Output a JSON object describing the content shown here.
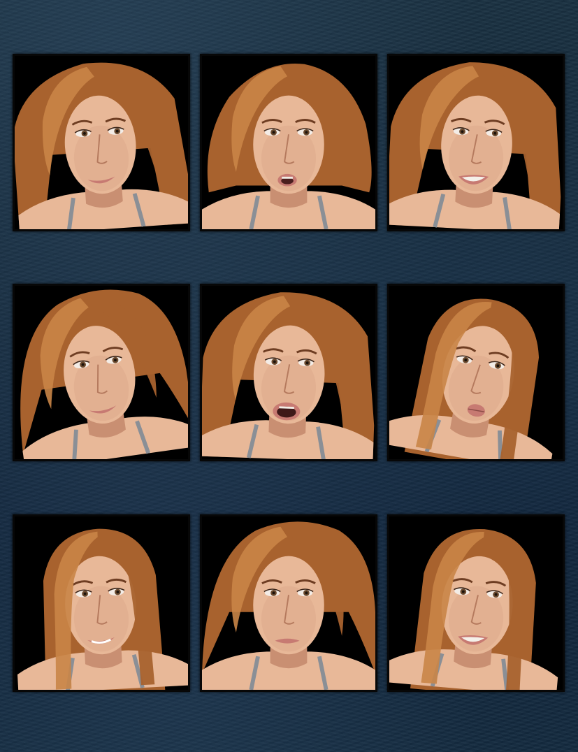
{
  "palette": {
    "background": "#13283a",
    "tile_frame": "#070707",
    "hair": "#a8622e",
    "hair_light": "#c98547",
    "skin": "#e8b898",
    "skin_shadow": "#c98f72",
    "lips": "#c77a72",
    "strap": "#8a8f96"
  },
  "portraits": [
    {
      "expression": "smile-look-aside",
      "hair": "long-swept",
      "tilt": -4,
      "mouth": "smile"
    },
    {
      "expression": "surprised",
      "hair": "wavy",
      "tilt": 0,
      "mouth": "open-small"
    },
    {
      "expression": "talking-smile",
      "hair": "long-swept",
      "tilt": 3,
      "mouth": "open-teeth"
    },
    {
      "expression": "sly-smile",
      "hair": "windblown",
      "tilt": -8,
      "mouth": "smirk"
    },
    {
      "expression": "shocked",
      "hair": "long",
      "tilt": 2,
      "mouth": "open-wide"
    },
    {
      "expression": "kiss-pout",
      "hair": "bob",
      "tilt": 10,
      "mouth": "pout"
    },
    {
      "expression": "grin",
      "hair": "bob",
      "tilt": -3,
      "mouth": "grin"
    },
    {
      "expression": "angry",
      "hair": "windblown",
      "tilt": 0,
      "mouth": "frown"
    },
    {
      "expression": "big-smile",
      "hair": "bob",
      "tilt": 5,
      "mouth": "teeth-smile"
    }
  ]
}
